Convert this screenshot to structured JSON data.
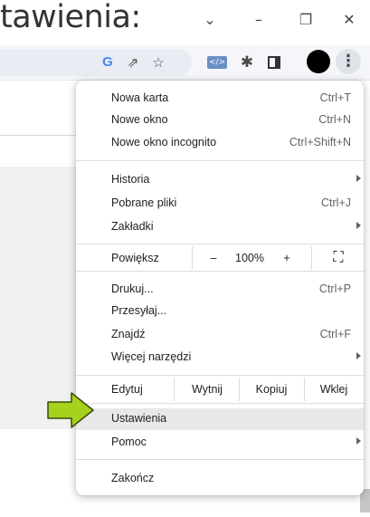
{
  "caption": {
    "text": "tawienia:"
  },
  "window": {
    "chevron": "⌄",
    "minimize": "–",
    "restore": "❐",
    "close": "✕"
  },
  "toolbar": {
    "icons": [
      "google-g-icon",
      "share-icon",
      "star-icon",
      "code-extension-icon",
      "puzzle-icon",
      "side-panel-icon",
      "profile-avatar-icon",
      "kebab-menu-icon"
    ],
    "google_g": "G",
    "share": "⇗",
    "star": "☆",
    "code": "</>",
    "puzzle": "✱",
    "kebab": "⋮",
    "accent": "#4285f4"
  },
  "menu": {
    "group1": [
      {
        "label": "Nowa karta",
        "shortcut": "Ctrl+T"
      },
      {
        "label": "Nowe okno",
        "shortcut": "Ctrl+N"
      },
      {
        "label": "Nowe okno incognito",
        "shortcut": "Ctrl+Shift+N"
      }
    ],
    "group2": [
      {
        "label": "Historia",
        "shortcut": ""
      },
      {
        "label": "Pobrane pliki",
        "shortcut": "Ctrl+J"
      },
      {
        "label": "Zakładki",
        "shortcut": ""
      }
    ],
    "zoom": {
      "label": "Powiększ",
      "minus": "–",
      "value": "100%",
      "plus": "+",
      "fullscreen": "⛶"
    },
    "group3": [
      {
        "label": "Drukuj...",
        "shortcut": "Ctrl+P"
      },
      {
        "label": "Przesyłaj...",
        "shortcut": ""
      },
      {
        "label": "Znajdź",
        "shortcut": "Ctrl+F"
      },
      {
        "label": "Więcej narzędzi",
        "shortcut": ""
      }
    ],
    "edit": {
      "label": "Edytuj",
      "cut": "Wytnij",
      "copy": "Kopiuj",
      "paste": "Wklej"
    },
    "group4": [
      {
        "label": "Ustawienia",
        "shortcut": ""
      },
      {
        "label": "Pomoc",
        "shortcut": ""
      }
    ],
    "exit": {
      "label": "Zakończ"
    }
  },
  "pointer": {
    "color": "#a6d21e",
    "outline": "#3a4a10"
  }
}
